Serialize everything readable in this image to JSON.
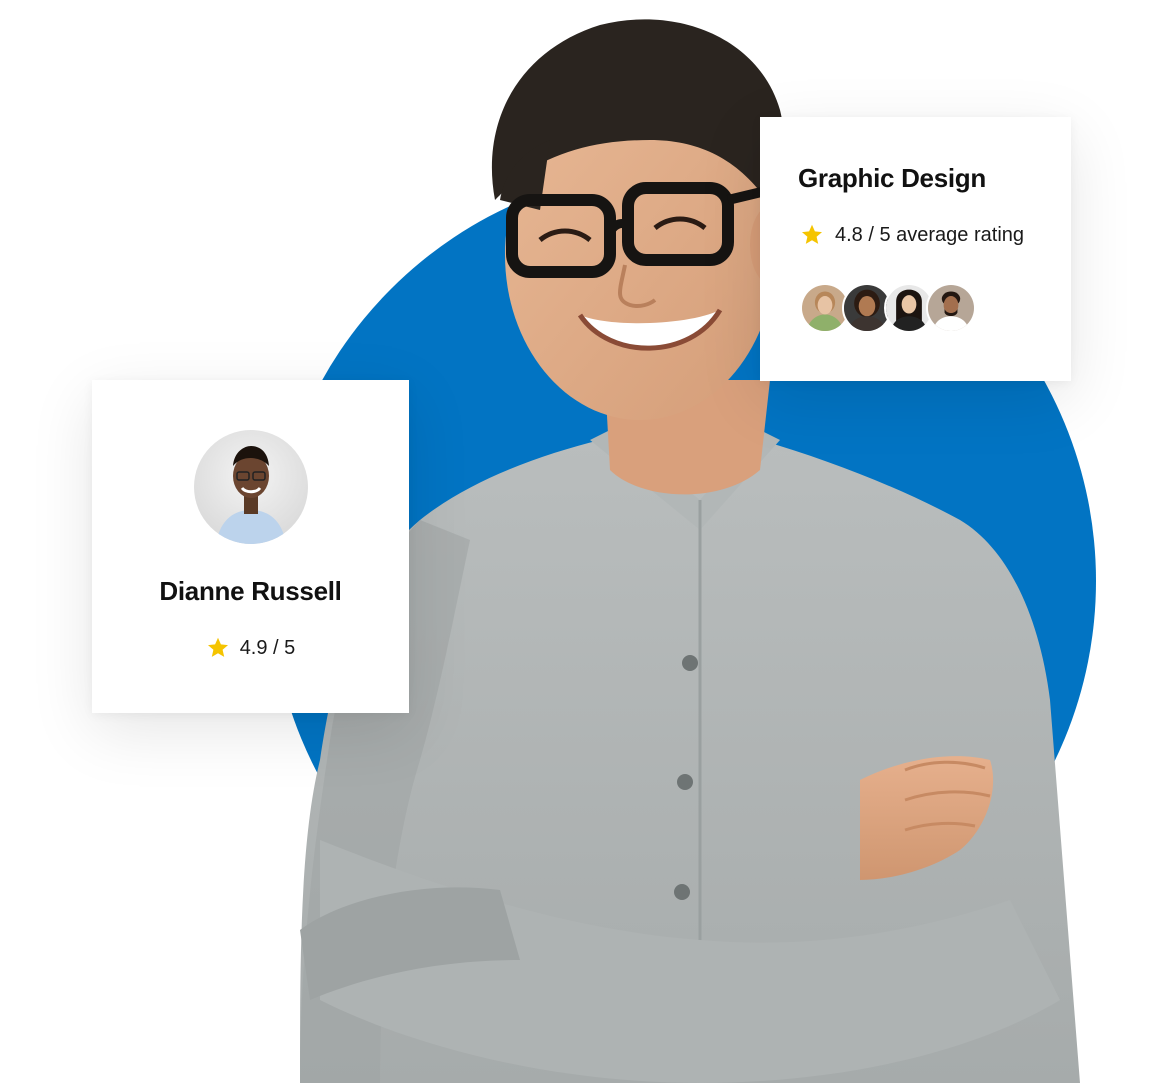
{
  "course_card": {
    "title": "Graphic Design",
    "rating": {
      "icon": "star-icon",
      "text": "4.8 / 5 average rating",
      "color": "#f5c400"
    },
    "reviewers": [
      {
        "name": "reviewer-avatar-1",
        "bg": "#c8a98a",
        "skin": "#e7c3a4",
        "hair": "#b7875a",
        "shirt": "#8fb06a"
      },
      {
        "name": "reviewer-avatar-2",
        "bg": "#3a3a3a",
        "skin": "#b07a52",
        "hair": "#2c1b12",
        "shirt": "#3d3430"
      },
      {
        "name": "reviewer-avatar-3",
        "bg": "#e8e8e8",
        "skin": "#e9c6a6",
        "hair": "#1c1410",
        "shirt": "#222222"
      },
      {
        "name": "reviewer-avatar-4",
        "bg": "#b6a697",
        "skin": "#a36f4e",
        "hair": "#231711",
        "shirt": "#ffffff"
      }
    ]
  },
  "tutor_card": {
    "name": "Dianne Russell",
    "rating": {
      "icon": "star-icon",
      "text": "4.9 / 5",
      "color": "#f5c400"
    }
  },
  "colors": {
    "accent_circle": "#0274c3",
    "card_bg": "#ffffff"
  }
}
